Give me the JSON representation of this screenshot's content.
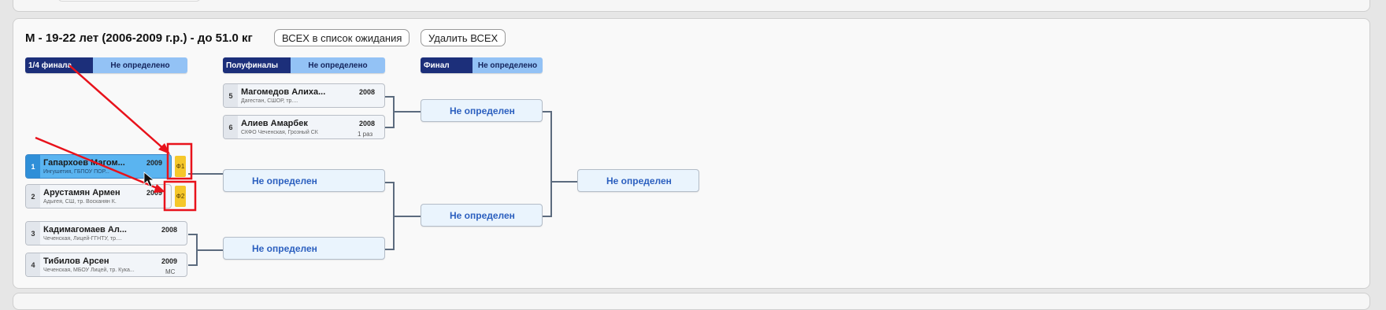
{
  "bracket": {
    "title": "М - 19-22 лет (2006-2009 г.р.) - до 51.0 кг",
    "waitlist_button": "ВСЕХ в список ожидания",
    "delete_button": "Удалить ВСЕХ",
    "rounds": [
      {
        "name": "1/4 финала",
        "status": "Не определено"
      },
      {
        "name": "Полуфиналы",
        "status": "Не определено"
      },
      {
        "name": "Финал",
        "status": "Не определено"
      }
    ],
    "quarter": [
      {
        "seed": "1",
        "name": "Гапархоев Магом...",
        "sub": "Ингушетия, ГБПОУ ПОР...",
        "year": "2009",
        "rank": "",
        "tag": "Ф1"
      },
      {
        "seed": "2",
        "name": "Арустамян Армен",
        "sub": "Адыгея, СШ, тр. Восканян К.",
        "year": "2009",
        "rank": "",
        "tag": "Ф2"
      },
      {
        "seed": "3",
        "name": "Кадимагомаев Ал...",
        "sub": "Чеченская, Лицей-ГГНТУ, тр....",
        "year": "2008",
        "rank": ""
      },
      {
        "seed": "4",
        "name": "Тибилов Арсен",
        "sub": "Чеченская, МБОУ Лицей, тр. Кука...",
        "year": "2009",
        "rank": "МС"
      }
    ],
    "semi_direct": [
      {
        "seed": "5",
        "name": "Магомедов Алиха...",
        "sub": "Дагестан, СШОР, тр....",
        "year": "2008",
        "rank": ""
      },
      {
        "seed": "6",
        "name": "Алиев Амарбек",
        "sub": "СКФО Чеченская, Грозный СК",
        "year": "2008",
        "rank": "1 раз"
      }
    ],
    "tbd_label": "Не определен"
  },
  "colors": {
    "round_dark": "#1c2f7a",
    "round_light": "#93c2f5",
    "selected": "#5ab4f0",
    "tag": "#f5c72a",
    "annotation": "#e8121b"
  }
}
